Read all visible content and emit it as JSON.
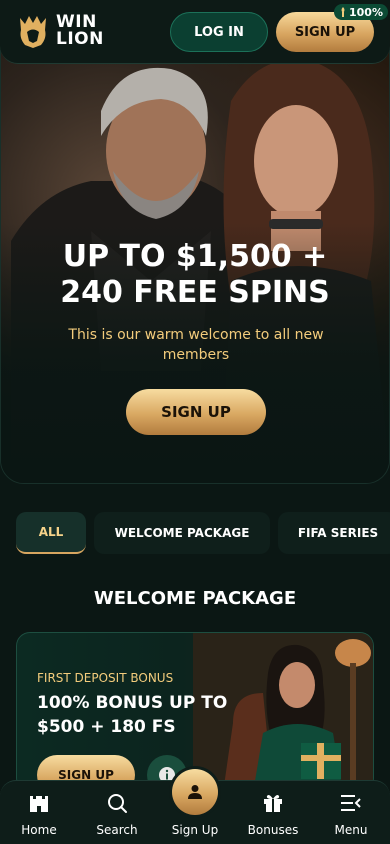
{
  "header": {
    "logo_line1": "WIN",
    "logo_line2": "LION",
    "login_label": "LOG IN",
    "signup_label": "SIGN UP",
    "badge_text": "100%"
  },
  "hero": {
    "title_line1": "UP TO $1,500 +",
    "title_line2": "240 FREE SPINS",
    "subtitle": "This is our warm welcome to all new members",
    "cta_label": "SIGN UP"
  },
  "tabs": [
    {
      "label": "ALL",
      "active": true
    },
    {
      "label": "WELCOME PACKAGE",
      "active": false
    },
    {
      "label": "FIFA SERIES",
      "active": false
    }
  ],
  "section": {
    "title": "WELCOME PACKAGE"
  },
  "promo_card": {
    "eyebrow": "FIRST DEPOSIT BONUS",
    "title": "100% BONUS UP TO $500 + 180 FS",
    "cta_label": "SIGN UP"
  },
  "bottom_nav": [
    {
      "label": "Home",
      "icon": "castle-icon"
    },
    {
      "label": "Search",
      "icon": "search-icon"
    },
    {
      "label": "Sign Up",
      "icon": "user-icon"
    },
    {
      "label": "Bonuses",
      "icon": "gift-icon"
    },
    {
      "label": "Menu",
      "icon": "menu-icon"
    }
  ],
  "colors": {
    "gold": "#d9a862",
    "accent_text": "#f3cc7c",
    "dark_green": "#0b3f31",
    "background": "#0b1714"
  }
}
